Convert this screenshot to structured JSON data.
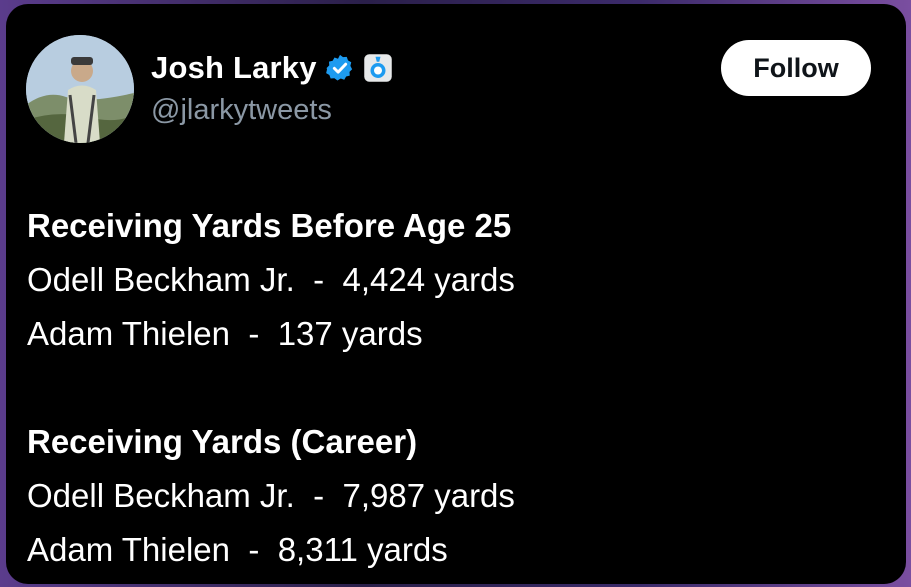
{
  "tweet": {
    "author_name": "Josh Larky",
    "handle": "@jlarkytweets",
    "follow_label": "Follow",
    "icons": {
      "verified": "verified-badge-icon",
      "bot": "automated-account-icon"
    },
    "colors": {
      "background": "#000000",
      "text": "#ffffff",
      "handle": "#8b98a5",
      "verified": "#1d9bf0"
    },
    "sections": [
      {
        "title": "Receiving Yards Before Age 25",
        "rows": [
          {
            "player": "Odell Beckham Jr.",
            "separator": "-",
            "value": "4,424 yards"
          },
          {
            "player": "Adam Thielen",
            "separator": "-",
            "value": "137 yards"
          }
        ]
      },
      {
        "title": "Receiving Yards (Career)",
        "rows": [
          {
            "player": "Odell Beckham Jr.",
            "separator": "-",
            "value": "7,987 yards"
          },
          {
            "player": "Adam Thielen",
            "separator": "-",
            "value": "8,311 yards"
          }
        ]
      }
    ]
  }
}
